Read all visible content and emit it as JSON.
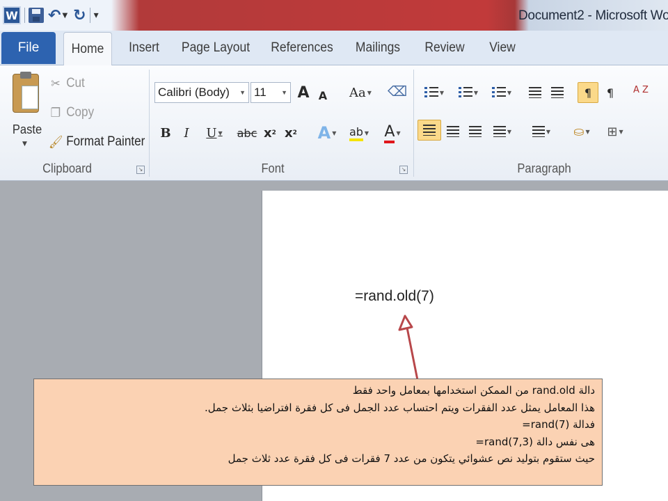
{
  "titlebar": {
    "title": "Document2 - Microsoft Wor",
    "app_icon_letter": "W",
    "icons": [
      "word-icon",
      "save-icon",
      "undo-icon",
      "redo-icon",
      "customize-qat-icon"
    ]
  },
  "tabs": {
    "file": "File",
    "items": [
      "Home",
      "Insert",
      "Page Layout",
      "References",
      "Mailings",
      "Review",
      "View"
    ],
    "active": "Home"
  },
  "clipboard": {
    "paste": "Paste",
    "cut": "Cut",
    "copy": "Copy",
    "format_painter": "Format Painter",
    "group_label": "Clipboard"
  },
  "font": {
    "font_name": "Calibri (Body)",
    "font_size": "11",
    "grow": "A",
    "shrink": "A",
    "change_case": "Aa",
    "bold": "B",
    "italic": "I",
    "underline": "U",
    "strikethrough": "abc",
    "subscript": "x",
    "superscript": "x",
    "text_effects": "A",
    "highlight": "ab",
    "font_color": "A",
    "group_label": "Font"
  },
  "paragraph": {
    "show_marks": "¶",
    "rtl": "¶",
    "sort": "A Z",
    "group_label": "Paragraph"
  },
  "document": {
    "formula": "=rand.old(7)"
  },
  "callout": {
    "lines": [
      "دالة rand.old من الممكن استخدامها بمعامل واحد فقط",
      "هذا المعامل يمثل عدد الفقرات ويتم احتساب عدد الجمل فى كل فقرة افتراضيا بثلاث جمل.",
      "فدالة (rand(7=",
      "هى نفس دالة (rand(7,3=",
      "حيث ستقوم بتوليد نص عشوائي يتكون من عدد 7 فقرات فى كل فقرة عدد ثلاث جمل"
    ],
    "colors": {
      "fill": "#fbd2b3",
      "arrow": "#b8474a"
    }
  }
}
